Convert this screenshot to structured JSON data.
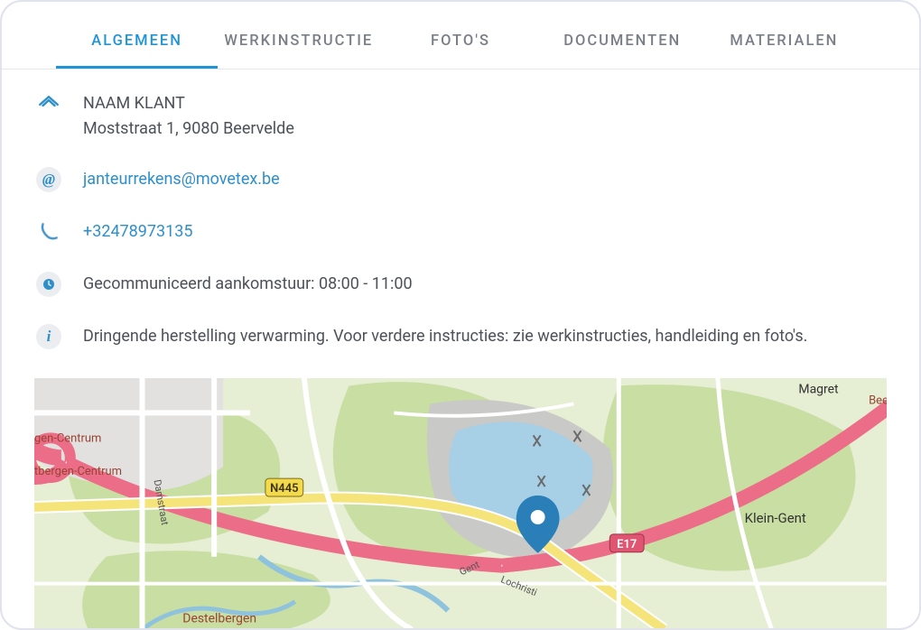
{
  "tabs": {
    "algemeen": "ALGEMEEN",
    "werkinstructie": "WERKINSTRUCTIE",
    "fotos": "FOTO'S",
    "documenten": "DOCUMENTEN",
    "materialen": "MATERIALEN"
  },
  "customer": {
    "name": "NAAM KLANT",
    "address": "Moststraat 1, 9080 Beervelde"
  },
  "contact": {
    "email": "janteurrekens@movetex.be",
    "phone": "+32478973135"
  },
  "arrival": "Gecommuniceerd aankomstuur: 08:00 - 11:00",
  "notes": "Dringende herstelling verwarming. Voor verdere instructies: zie werkinstructies, handleiding en foto's.",
  "map": {
    "labels": {
      "magret": "Magret",
      "kleinGent": "Klein-Gent",
      "damstraat": "Damstraat",
      "destelbergen": "Destelbergen",
      "tbergenC": "tbergen-Centrum",
      "genC": "gen-Centrum",
      "gent": "Gent",
      "lochristi": "Lochristi",
      "beers": "Beers",
      "n445": "N445",
      "e17": "E17"
    }
  }
}
